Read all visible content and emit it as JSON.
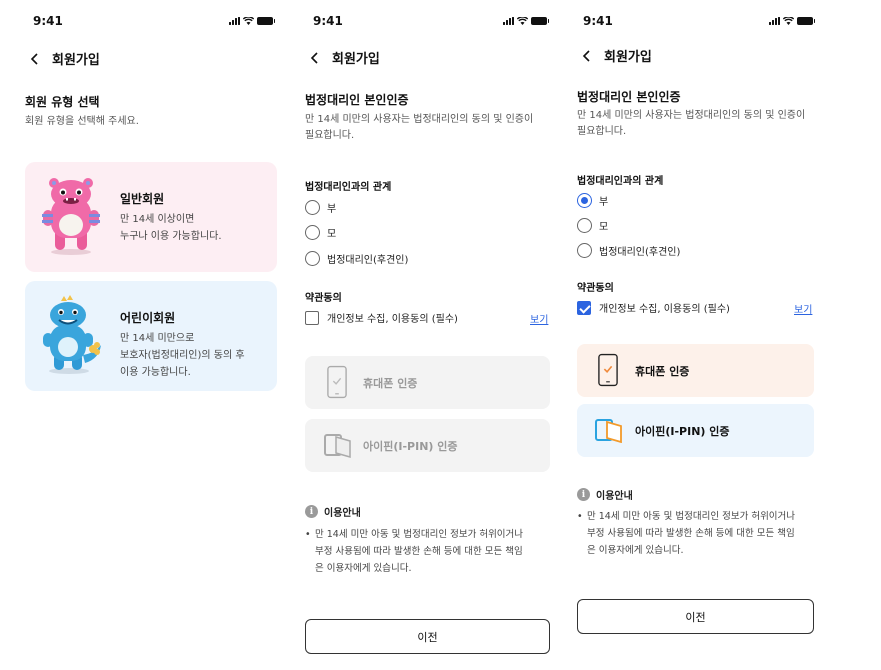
{
  "status": {
    "time": "9:41"
  },
  "header": {
    "title": "회원가입"
  },
  "colors": {
    "accent": "#2c64e0",
    "general_card_bg": "#fdeef3",
    "child_card_bg": "#eaf4fd",
    "phone_active_bg": "#fdf1ea",
    "ipin_active_bg": "#ecf5fd",
    "disabled_bg": "#f3f3f3"
  },
  "screen1": {
    "title": "회원 유형 선택",
    "description": "회원 유형을 선택해 주세요.",
    "cards": [
      {
        "title": "일반회원",
        "desc_line1": "만 14세 이상이면",
        "desc_line2": "누구나 이용 가능합니다.",
        "mascot": "pink-monster"
      },
      {
        "title": "어린이회원",
        "desc_line1": "만 14세 미만으로",
        "desc_line2": "보호자(법정대리인)의 동의 후",
        "desc_line3": "이용 가능합니다.",
        "mascot": "blue-dinosaur"
      }
    ]
  },
  "guardian": {
    "title": "법정대리인 본인인증",
    "desc_line1": "만 14세 미만의 사용자는 법정대리인의 동의 및 인증이",
    "desc_line2": "필요합니다.",
    "relation_label": "법정대리인과의 관계",
    "relations": [
      "부",
      "모",
      "법정대리인(후견인)"
    ],
    "terms_label": "약관동의",
    "terms_item": "개인정보 수집, 이용동의 (필수)",
    "terms_view": "보기",
    "phone_auth": "휴대폰 인증",
    "ipin_auth": "아이핀(I-PIN) 인증",
    "info_title": "이용안내",
    "info_bullet": "•",
    "info_line1": "만 14세 미만 아동 및 법정대리인 정보가 허위이거나",
    "info_line2": "부정 사용됨에 따라 발생한 손해 등에 대한 모든 책임",
    "info_line3": "은 이용자에게 있습니다.",
    "prev_button": "이전"
  },
  "screen2_state": {
    "selected_relation": null,
    "terms_checked": false,
    "auth_enabled": false
  },
  "screen3_state": {
    "selected_relation": "부",
    "terms_checked": true,
    "auth_enabled": true
  }
}
